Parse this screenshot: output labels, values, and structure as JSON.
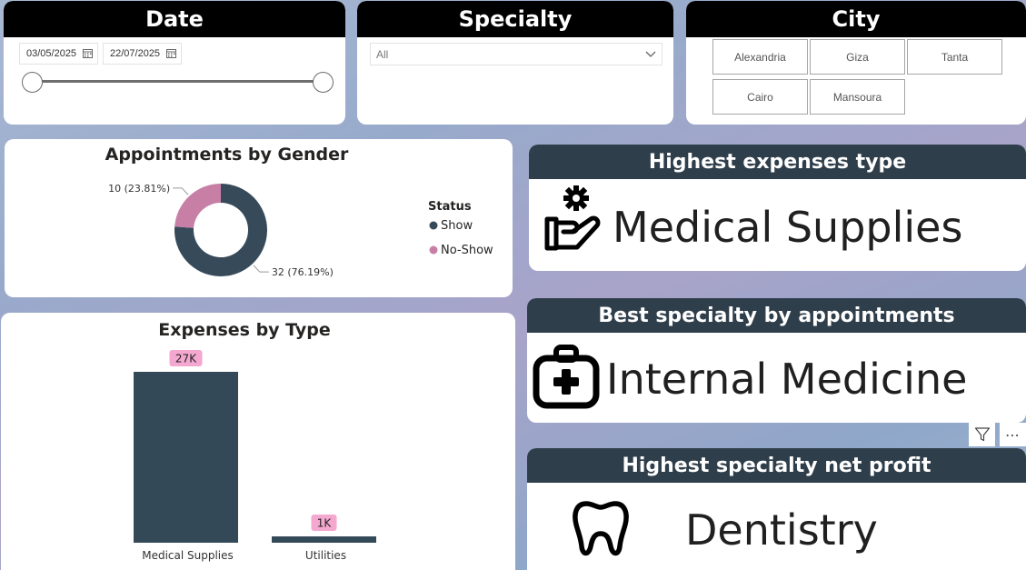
{
  "date_slicer": {
    "title": "Date",
    "start": "03/05/2025",
    "end": "22/07/2025"
  },
  "specialty_slicer": {
    "title": "Specialty",
    "selected": "All"
  },
  "city_slicer": {
    "title": "City",
    "options": [
      "Alexandria",
      "Giza",
      "Tanta",
      "Cairo",
      "Mansoura"
    ]
  },
  "gender_chart": {
    "title": "Appointments by Gender",
    "legend_title": "Status",
    "legend": [
      "Show",
      "No-Show"
    ]
  },
  "expenses_chart": {
    "title": "Expenses by Type"
  },
  "chart_data": [
    {
      "type": "pie",
      "title": "Appointments by Gender",
      "legend_title": "Status",
      "categories": [
        "Show",
        "No-Show"
      ],
      "values": [
        32,
        10
      ],
      "labels": [
        "32 (76.19%)",
        "10 (23.81%)"
      ],
      "colors": [
        "#374a5a",
        "#c77fa5"
      ],
      "legend_position": "right"
    },
    {
      "type": "bar",
      "title": "Expenses by Type",
      "categories": [
        "Medical Supplies",
        "Utilities"
      ],
      "values": [
        27000,
        1000
      ],
      "data_labels": [
        "27K",
        "1K"
      ],
      "ylim": [
        0,
        27000
      ],
      "colors": {
        "bar": "#344958",
        "label_bg": "#f4a7cf"
      }
    }
  ],
  "kpis": {
    "expenses_type": {
      "title": "Highest expenses type",
      "value": "Medical Supplies",
      "icon": "hand-gear-icon"
    },
    "best_specialty": {
      "title": "Best specialty by appointments",
      "value": "Internal Medicine",
      "icon": "medical-kit-icon"
    },
    "net_profit": {
      "title": "Highest specialty net profit",
      "value": "Dentistry",
      "icon": "tooth-icon"
    }
  },
  "visual_toolbar": {
    "more_label": "⋯"
  },
  "colors": {
    "slicer_header": "#000000",
    "kpi_header": "#2f3e4b",
    "show": "#374a5a",
    "no_show": "#c77fa5"
  }
}
